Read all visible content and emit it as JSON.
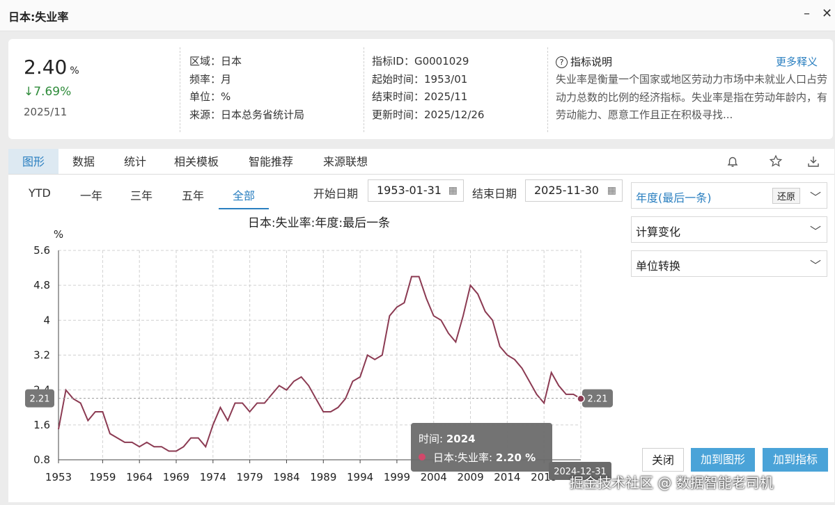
{
  "window": {
    "title": "日本:失业率",
    "min_icon": "minimize-icon",
    "close_icon": "close-icon"
  },
  "summary": {
    "value": "2.40",
    "value_unit": "%",
    "change": "↓7.69%",
    "date": "2025/11",
    "region": "区域：日本",
    "frequency": "频率：月",
    "unit": "单位：%",
    "source": "来源：日本总务省统计局",
    "indicator_id": "指标ID：G0001029",
    "start_time": "起始时间：1953/01",
    "end_time": "结束时间：2025/11",
    "update_time": "更新时间：2025/12/26",
    "note_title": "指标说明",
    "note_more": "更多释义",
    "note_body": "失业率是衡量一个国家或地区劳动力市场中未就业人口占劳动力总数的比例的经济指标。失业率是指在劳动年龄内，有劳动能力、愿意工作且正在积极寻找..."
  },
  "tabs": [
    "图形",
    "数据",
    "统计",
    "相关模板",
    "智能推荐",
    "来源联想"
  ],
  "toolbar_icons": [
    "bell-icon",
    "star-icon",
    "download-icon"
  ],
  "ranges": [
    "YTD",
    "一年",
    "三年",
    "五年",
    "全部"
  ],
  "dates": {
    "start_label": "开始日期",
    "start_value": "1953-01-31",
    "end_label": "结束日期",
    "end_value": "2025-11-30"
  },
  "side": {
    "frequency_select": "年度(最后一条)",
    "reset": "还原",
    "calc": "计算变化",
    "unit_convert": "单位转换"
  },
  "buttons": {
    "close": "关闭",
    "add_chart": "加到图形",
    "add_indicator": "加到指标"
  },
  "colors": {
    "series": "#8b3a52",
    "accent": "#2a7fc0",
    "button": "#4aa3d8"
  },
  "watermark": "掘金技术社区 @ 数据智能老司机",
  "chart_data": {
    "type": "line",
    "title": "日本:失业率:年度:最后一条",
    "ylabel": "%",
    "ylim": [
      0.8,
      5.6
    ],
    "yticks": [
      "0.8",
      "1.6",
      "2.4",
      "3.2",
      "4",
      "4.8",
      "5.6"
    ],
    "xticks": [
      "1953",
      "1959",
      "1964",
      "1969",
      "1974",
      "1979",
      "1984",
      "1989",
      "1994",
      "1999",
      "2004",
      "2009",
      "2014",
      "2019"
    ],
    "grid": true,
    "series": [
      {
        "name": "日本:失业率",
        "x": [
          1953,
          1954,
          1955,
          1956,
          1957,
          1958,
          1959,
          1960,
          1961,
          1962,
          1963,
          1964,
          1965,
          1966,
          1967,
          1968,
          1969,
          1970,
          1971,
          1972,
          1973,
          1974,
          1975,
          1976,
          1977,
          1978,
          1979,
          1980,
          1981,
          1982,
          1983,
          1984,
          1985,
          1986,
          1987,
          1988,
          1989,
          1990,
          1991,
          1992,
          1993,
          1994,
          1995,
          1996,
          1997,
          1998,
          1999,
          2000,
          2001,
          2002,
          2003,
          2004,
          2005,
          2006,
          2007,
          2008,
          2009,
          2010,
          2011,
          2012,
          2013,
          2014,
          2015,
          2016,
          2017,
          2018,
          2019,
          2020,
          2021,
          2022,
          2023,
          2024
        ],
        "values": [
          1.5,
          2.4,
          2.2,
          2.1,
          1.7,
          1.9,
          1.9,
          1.4,
          1.3,
          1.2,
          1.2,
          1.1,
          1.2,
          1.1,
          1.1,
          1.0,
          1.0,
          1.1,
          1.3,
          1.3,
          1.1,
          1.6,
          2.0,
          1.7,
          2.1,
          2.1,
          1.9,
          2.1,
          2.1,
          2.3,
          2.5,
          2.4,
          2.6,
          2.7,
          2.5,
          2.2,
          1.9,
          1.9,
          2.0,
          2.2,
          2.6,
          2.7,
          3.2,
          3.1,
          3.2,
          4.1,
          4.3,
          4.4,
          5.0,
          5.0,
          4.5,
          4.1,
          4.0,
          3.7,
          3.5,
          4.1,
          4.8,
          4.6,
          4.2,
          4.0,
          3.4,
          3.2,
          3.1,
          2.9,
          2.6,
          2.3,
          2.1,
          2.8,
          2.5,
          2.3,
          2.3,
          2.2
        ]
      }
    ],
    "end_label": "2.21",
    "tooltip": {
      "time_label": "时间:",
      "time": "2024",
      "series_label": "日本:失业率:",
      "value": "2.20",
      "unit": "%"
    },
    "x_badge": "2024-12-31"
  }
}
